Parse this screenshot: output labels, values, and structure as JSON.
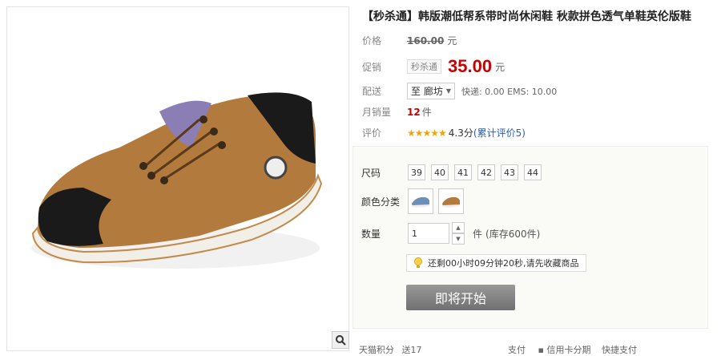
{
  "product": {
    "title": "【秒杀通】韩版潮低帮系带时尚休闲鞋 秋款拼色透气单鞋英伦版鞋"
  },
  "price": {
    "label": "价格",
    "value": "160.00",
    "unit": "元"
  },
  "promo": {
    "label": "促销",
    "tag": "秒杀通",
    "price": "35.00",
    "unit": "元"
  },
  "shipping": {
    "label": "配送",
    "destination": "至 廊坊",
    "rates": "快递: 0.00 EMS: 10.00"
  },
  "monthly_sales": {
    "label": "月销量",
    "value": "12",
    "unit": "件"
  },
  "rating": {
    "label": "评价",
    "stars": "★★★★★",
    "score": "4.3分",
    "link": "(累计评价5)"
  },
  "options": {
    "size_label": "尺码",
    "sizes": [
      "39",
      "40",
      "41",
      "42",
      "43",
      "44"
    ],
    "color_label": "颜色分类",
    "qty_label": "数量",
    "qty_value": "1",
    "qty_unit": "件",
    "stock": "(库存600件)",
    "tip": "还剩00小时09分钟20秒,请先收藏商品",
    "buy_button": "即将开始"
  },
  "bottom": {
    "left_label": "天猫积分",
    "left_value": "送17",
    "pay_label": "支付",
    "pay_option": "信用卡分期",
    "fast_pay": "快捷支付"
  },
  "colors": {
    "accent": "#cc0000",
    "button": "#808080",
    "star": "#f4a400"
  }
}
